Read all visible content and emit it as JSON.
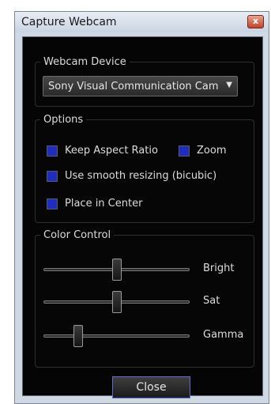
{
  "window": {
    "title": "Capture Webcam",
    "close_label": "x"
  },
  "webcam_device": {
    "legend": "Webcam Device",
    "selected": "Sony Visual Communication Cam",
    "arrow": "▼"
  },
  "options": {
    "legend": "Options",
    "keep_aspect_ratio": {
      "label": "Keep Aspect Ratio",
      "checked": true
    },
    "zoom": {
      "label": "Zoom",
      "checked": true
    },
    "smooth_resizing": {
      "label": "Use smooth resizing (bicubic)",
      "checked": true
    },
    "place_in_center": {
      "label": "Place in Center",
      "checked": true
    }
  },
  "color_control": {
    "legend": "Color Control",
    "sliders": [
      {
        "label": "Bright",
        "level": 0.5
      },
      {
        "label": "Sat",
        "level": 0.5
      },
      {
        "label": "Gamma",
        "level": 0.22
      }
    ]
  },
  "buttons": {
    "close": "Close"
  },
  "colors": {
    "background": "#050505",
    "checkbox_fill": "#1f2dbf",
    "button_border": "#5a6fd1",
    "close_x": "#c24229"
  }
}
